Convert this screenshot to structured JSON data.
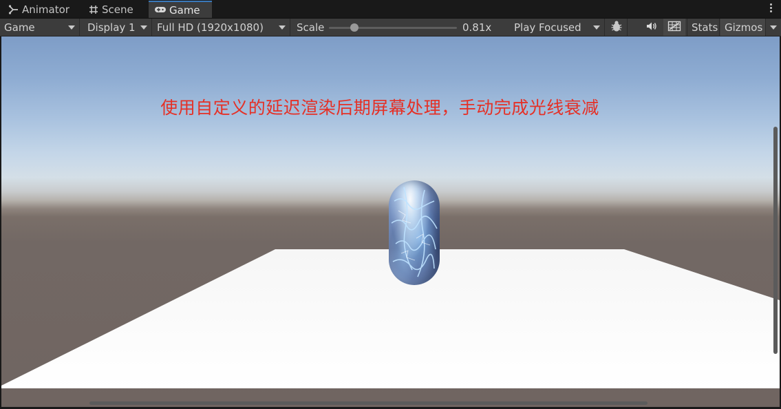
{
  "tabs": [
    {
      "label": "Animator",
      "icon": "animator-icon",
      "active": false
    },
    {
      "label": "Scene",
      "icon": "scene-grid-icon",
      "active": false
    },
    {
      "label": "Game",
      "icon": "gamepad-icon",
      "active": true
    }
  ],
  "toolbar": {
    "view_mode": "Game",
    "display": "Display 1",
    "resolution": "Full HD (1920x1080)",
    "scale_label": "Scale",
    "scale_value": "0.81x",
    "scale_fraction": 0.2,
    "play_mode": "Play Focused",
    "stats_label": "Stats",
    "gizmos_label": "Gizmos"
  },
  "viewport": {
    "overlay_text": "使用自定义的延迟渲染后期屏幕处理，手动完成光线衰减"
  },
  "colors": {
    "accent_tab": "#3a79bb",
    "overlay_text": "#e53026"
  }
}
